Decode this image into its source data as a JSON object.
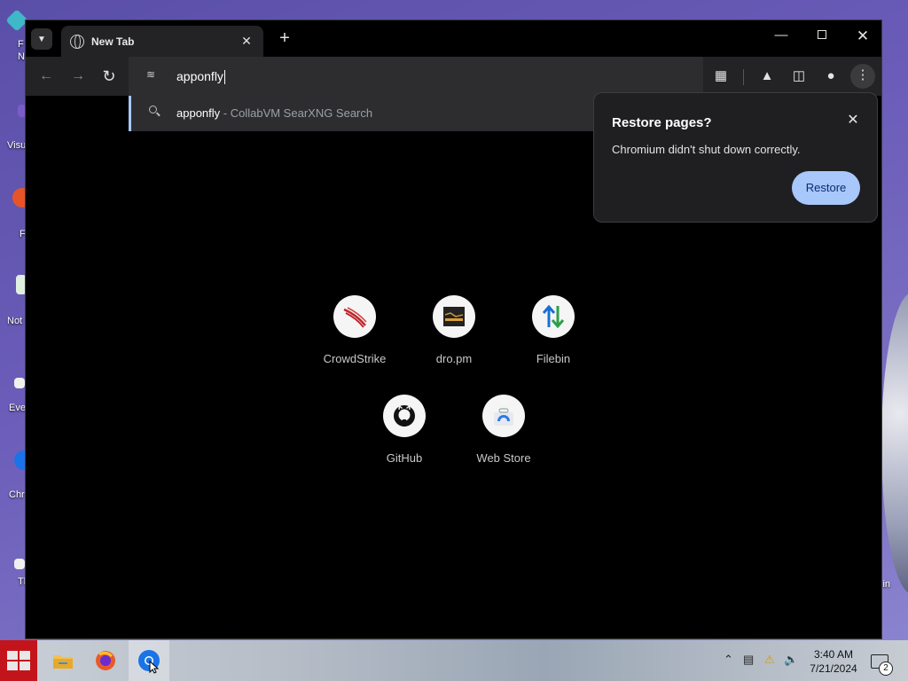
{
  "desktop": {
    "icon_labels": [
      "F",
      "N",
      "Visu",
      "F",
      "Not",
      "Eve",
      "Chr",
      "Th"
    ],
    "right_label": "in"
  },
  "browser": {
    "tab": {
      "title": "New Tab"
    },
    "omnibox": {
      "value": "apponfly"
    },
    "suggestion": {
      "query": "apponfly",
      "separator": " - ",
      "engine": "CollabVM SearXNG Search"
    },
    "restore_bubble": {
      "title": "Restore pages?",
      "message": "Chromium didn't shut down correctly.",
      "button": "Restore"
    },
    "shortcuts": [
      {
        "label": "CrowdStrike",
        "icon": "crowdstrike-icon"
      },
      {
        "label": "dro.pm",
        "icon": "dropm-icon"
      },
      {
        "label": "Filebin",
        "icon": "filebin-icon"
      },
      {
        "label": "GitHub",
        "icon": "github-icon"
      },
      {
        "label": "Web Store",
        "icon": "webstore-icon"
      }
    ]
  },
  "taskbar": {
    "time": "3:40 AM",
    "date": "7/21/2024",
    "notification_count": "2"
  },
  "colors": {
    "accent": "#a8c7fa",
    "start_button": "#c4141b"
  }
}
